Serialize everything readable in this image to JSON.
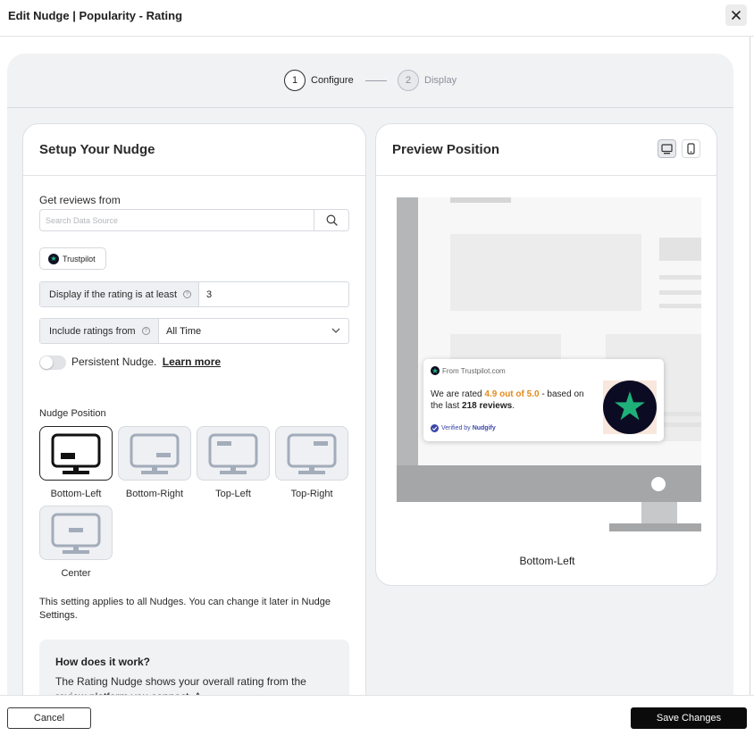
{
  "header": {
    "title": "Edit Nudge | Popularity - Rating"
  },
  "stepper": {
    "steps": [
      {
        "number": "1",
        "label": "Configure"
      },
      {
        "number": "2",
        "label": "Display"
      }
    ],
    "active_step": 1
  },
  "setup": {
    "title": "Setup Your Nudge",
    "reviews_label": "Get reviews from",
    "search_placeholder": "Search Data Source",
    "source_chip": "Trustpilot",
    "min_rating_label": "Display if the rating is at least",
    "min_rating_value": "3",
    "include_label": "Include ratings from",
    "include_value": "All Time",
    "persistent_label": "Persistent Nudge.",
    "persistent_link": "Learn more",
    "persistent_on": false,
    "position_label": "Nudge Position",
    "positions": [
      "Bottom-Left",
      "Bottom-Right",
      "Top-Left",
      "Top-Right",
      "Center"
    ],
    "selected_position": "Bottom-Left",
    "note_prefix": "This setting applies to all Nudges. You can change it later in",
    "note_link": "Nudge Settings",
    "note_suffix": ".",
    "how_title": "How does it work?",
    "how_text": "The Rating Nudge shows your overall rating from the review platform you connect. A"
  },
  "preview": {
    "title": "Preview Position",
    "caption": "Bottom-Left",
    "nudge": {
      "from": "From Trustpilot.com",
      "text_prefix": "We are rated",
      "rating": "4.9 out of 5.0",
      "text_mid": "- based on the last",
      "reviews": "218 reviews",
      "text_end": ".",
      "verified_prefix": "Verified by",
      "verified_brand": "Nudgify"
    }
  },
  "footer": {
    "cancel": "Cancel",
    "save": "Save Changes"
  },
  "colors": {
    "accent_orange": "#e38a1c",
    "trustpilot_green": "#1fb07a",
    "verified_blue": "#3a46a8",
    "primary_button": "#0b0b0b"
  },
  "icons": {
    "close": "close-icon",
    "search": "search-icon",
    "help": "question-circle-icon",
    "dropdown": "chevron-down-icon",
    "desktop": "desktop-icon",
    "mobile": "mobile-icon",
    "trustpilot": "star-icon"
  }
}
